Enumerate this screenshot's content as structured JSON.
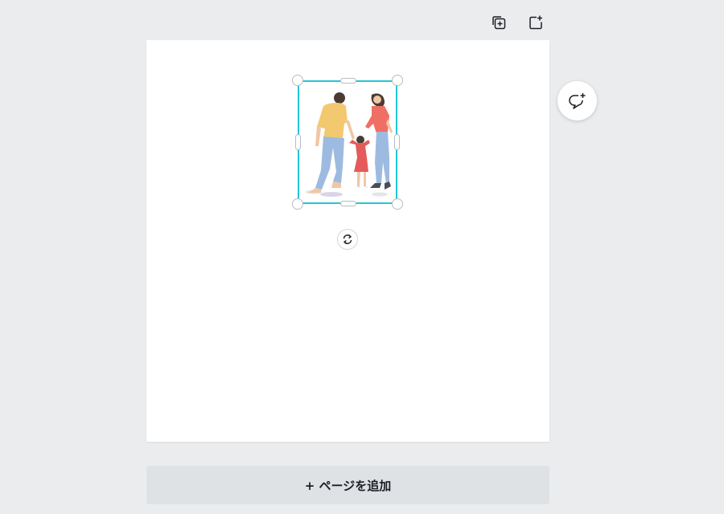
{
  "toolbar": {
    "duplicate_icon": "duplicate-page-icon",
    "add_icon": "add-page-icon"
  },
  "canvas": {
    "page_background": "#ffffff",
    "selection_color": "#21c7d6",
    "image_subject": "watercolor-family-illustration"
  },
  "rotate": {
    "icon": "rotate-icon"
  },
  "comment": {
    "icon": "add-comment-icon"
  },
  "add_page": {
    "label": "+ ページを追加"
  }
}
